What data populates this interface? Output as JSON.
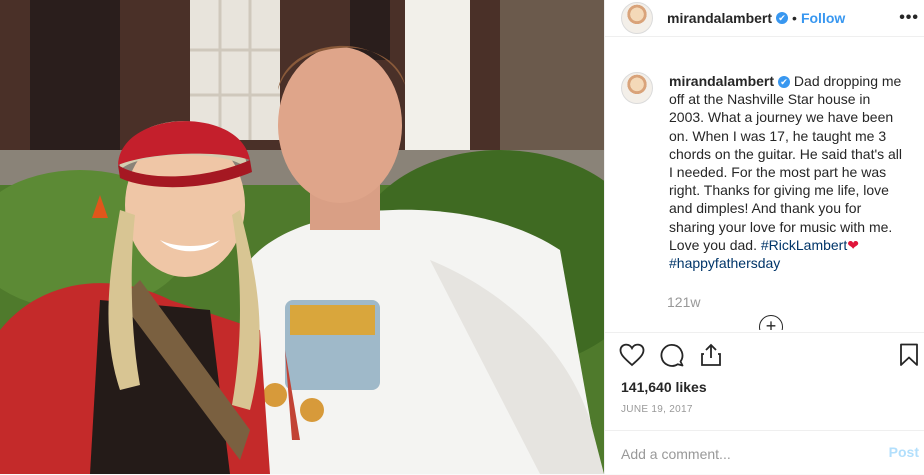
{
  "post": {
    "username": "mirandalambert",
    "verified_symbol": "✔",
    "separator": "•",
    "follow_label": "Follow",
    "more_icon": "more-options-icon",
    "more_label": "•••",
    "caption": {
      "username": "mirandalambert",
      "text": " Dad dropping me off at the Nashville Star house in 2003. What a journey we have been on. When I was 17, he taught me 3 chords on the guitar. He said that's all I needed. For the most part he was right. Thanks for giving me life, love and dimples! And thank you for sharing your love for music with me. Love you dad. ",
      "hashtag_1": "#RickLambert",
      "heart": "❤",
      "hashtag_2": "#happyfathersday"
    },
    "caption_age": "121w",
    "load_more_label": "+",
    "likes": "141,640 likes",
    "date": "JUNE 19, 2017",
    "comment_placeholder": "Add a comment...",
    "post_label": "Post",
    "colors": {
      "accent": "#3897f0",
      "hashtag": "#003569",
      "muted": "#999999",
      "post_disabled": "#b2dffc"
    }
  }
}
